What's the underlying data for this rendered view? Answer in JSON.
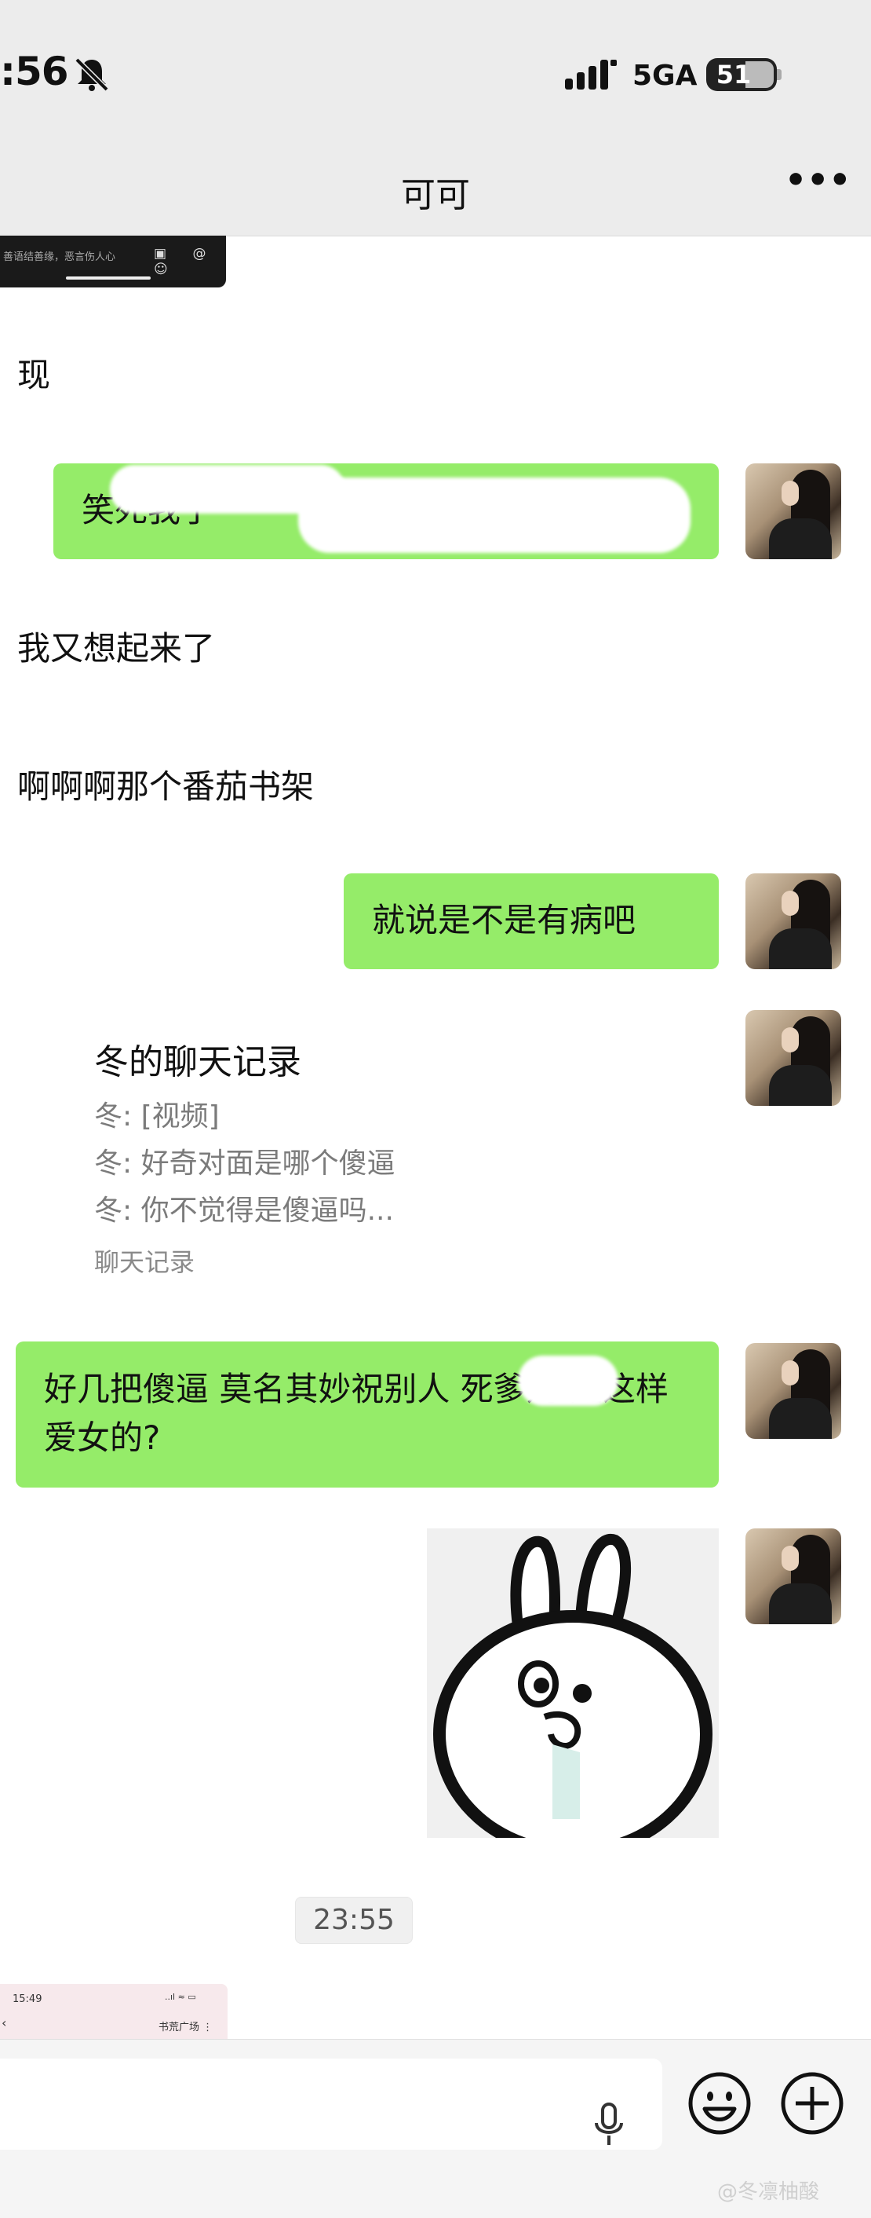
{
  "status_bar": {
    "time": ":56",
    "network": "5GA",
    "battery": "51"
  },
  "header": {
    "title": "可可",
    "more": "•••"
  },
  "top_thumbnail": {
    "caption": "善语结善缘，恶言伤人心",
    "icons": "▣ @ ☺"
  },
  "messages": [
    {
      "side": "in",
      "text": "现"
    },
    {
      "side": "out",
      "text": "笑死我了"
    },
    {
      "side": "in",
      "text": "我又想起来了"
    },
    {
      "side": "in",
      "text": "啊啊啊那个番茄书架"
    },
    {
      "side": "out",
      "text": "就说是不是有病吧"
    },
    {
      "side": "out",
      "text": "好几把傻逼 莫名其妙祝别人 死爹妈 是这样爱女的?"
    }
  ],
  "chat_record_card": {
    "title": "冬的聊天记录",
    "lines": [
      "冬: [视频]",
      "冬: 好奇对面是哪个傻逼",
      "冬: 你不觉得是傻逼吗..."
    ],
    "footer": "聊天记录"
  },
  "timestamp": "23:55",
  "bottom_thumbnail": {
    "time": "15:49",
    "status_icons": "..ıl ≈ ▭",
    "back": "‹",
    "label": "书荒广场",
    "menu": "⋮"
  },
  "watermark": "@冬凛柚酸",
  "colors": {
    "out_bubble": "#95ec69",
    "in_bubble": "#ffffff",
    "background": "#ffffff",
    "bar": "#ececec"
  }
}
